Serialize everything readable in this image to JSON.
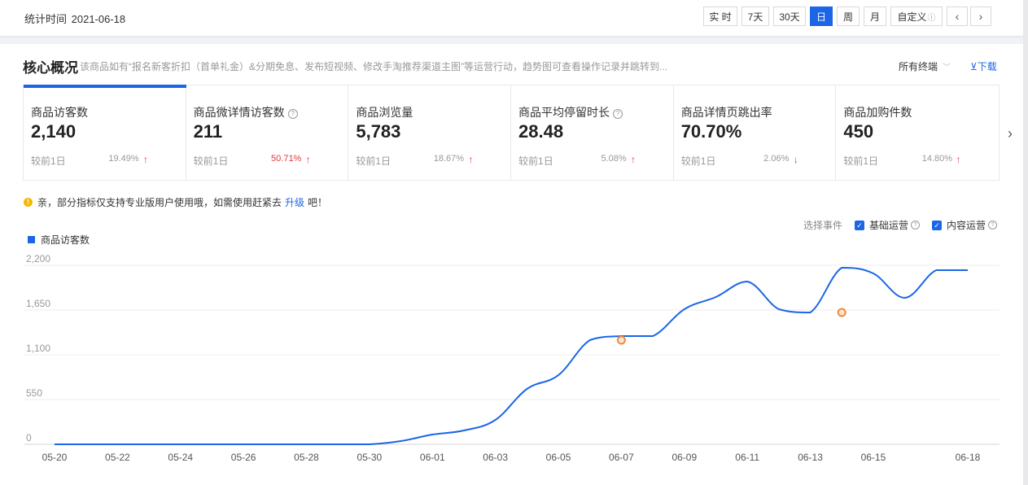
{
  "header": {
    "stat_time_label": "统计时间",
    "stat_date": "2021-06-18",
    "ranges": [
      {
        "label": "实 时",
        "active": false
      },
      {
        "label": "7天",
        "active": false
      },
      {
        "label": "30天",
        "active": false
      },
      {
        "label": "日",
        "active": true
      },
      {
        "label": "周",
        "active": false
      },
      {
        "label": "月",
        "active": false
      },
      {
        "label": "自定义",
        "active": false
      }
    ],
    "prev_glyph": "‹",
    "next_glyph": "›"
  },
  "panel": {
    "title": "核心概况",
    "description": "该商品如有“报名新客折扣（首单礼金）&分期免息、发布短视频、修改手淘推荐渠道主图”等运营行动，趋势图可查看操作记录并跳转到...",
    "terminal": "所有终端",
    "download": "⊻下载"
  },
  "cards": [
    {
      "label": "商品访客数",
      "help": false,
      "value": "2,140",
      "compare": "较前1日",
      "pct": "19.49%",
      "dir": "up",
      "pct_red": false,
      "active": true
    },
    {
      "label": "商品微详情访客数",
      "help": true,
      "value": "211",
      "compare": "较前1日",
      "pct": "50.71%",
      "dir": "up",
      "pct_red": true,
      "active": false
    },
    {
      "label": "商品浏览量",
      "help": false,
      "value": "5,783",
      "compare": "较前1日",
      "pct": "18.67%",
      "dir": "up",
      "pct_red": false,
      "active": false
    },
    {
      "label": "商品平均停留时长",
      "help": true,
      "value": "28.48",
      "compare": "较前1日",
      "pct": "5.08%",
      "dir": "up",
      "pct_red": false,
      "active": false
    },
    {
      "label": "商品详情页跳出率",
      "help": false,
      "value": "70.70%",
      "compare": "较前1日",
      "pct": "2.06%",
      "dir": "down",
      "pct_red": false,
      "active": false
    },
    {
      "label": "商品加购件数",
      "help": false,
      "value": "450",
      "compare": "较前1日",
      "pct": "14.80%",
      "dir": "up",
      "pct_red": false,
      "active": false
    }
  ],
  "notice": {
    "text_before": "亲，部分指标仅支持专业版用户使用哦，如需使用赶紧去",
    "link": "升级",
    "text_after": "吧！"
  },
  "events": {
    "label": "选择事件",
    "options": [
      {
        "label": "基础运营",
        "checked": true
      },
      {
        "label": "内容运营",
        "checked": true
      }
    ]
  },
  "colors": {
    "accent": "#1a66e6",
    "up": "#e53935",
    "down": "#1aa33b",
    "marker": "#f08a3c"
  },
  "chart_data": {
    "type": "line",
    "title": "",
    "xlabel": "",
    "ylabel": "",
    "ylim": [
      0,
      2200
    ],
    "yticks": [
      0,
      550,
      1100,
      1650,
      2200
    ],
    "ytick_labels": [
      "0",
      "550",
      "1,100",
      "1,650",
      "2,200"
    ],
    "x": [
      "05-20",
      "05-21",
      "05-22",
      "05-23",
      "05-24",
      "05-25",
      "05-26",
      "05-27",
      "05-28",
      "05-29",
      "05-30",
      "05-31",
      "06-01",
      "06-02",
      "06-03",
      "06-04",
      "06-05",
      "06-06",
      "06-07",
      "06-08",
      "06-09",
      "06-10",
      "06-11",
      "06-12",
      "06-13",
      "06-14",
      "06-15",
      "06-16",
      "06-17",
      "06-18"
    ],
    "xtick_labels": [
      "05-20",
      "05-22",
      "05-24",
      "05-26",
      "05-28",
      "05-30",
      "06-01",
      "06-03",
      "06-05",
      "06-07",
      "06-09",
      "06-11",
      "06-13",
      "06-15",
      "06-18"
    ],
    "series": [
      {
        "name": "商品访客数",
        "color": "#1a66e6",
        "values": [
          0,
          0,
          0,
          0,
          0,
          0,
          0,
          0,
          0,
          0,
          0,
          40,
          120,
          170,
          300,
          680,
          850,
          1280,
          1330,
          1330,
          1660,
          1810,
          2000,
          1660,
          1620,
          2170,
          2100,
          1800,
          2140,
          2140
        ]
      }
    ],
    "markers": [
      {
        "x": "06-07",
        "value": 1280
      },
      {
        "x": "06-14",
        "value": 1620
      }
    ],
    "grid": true,
    "legend": "top-left"
  }
}
